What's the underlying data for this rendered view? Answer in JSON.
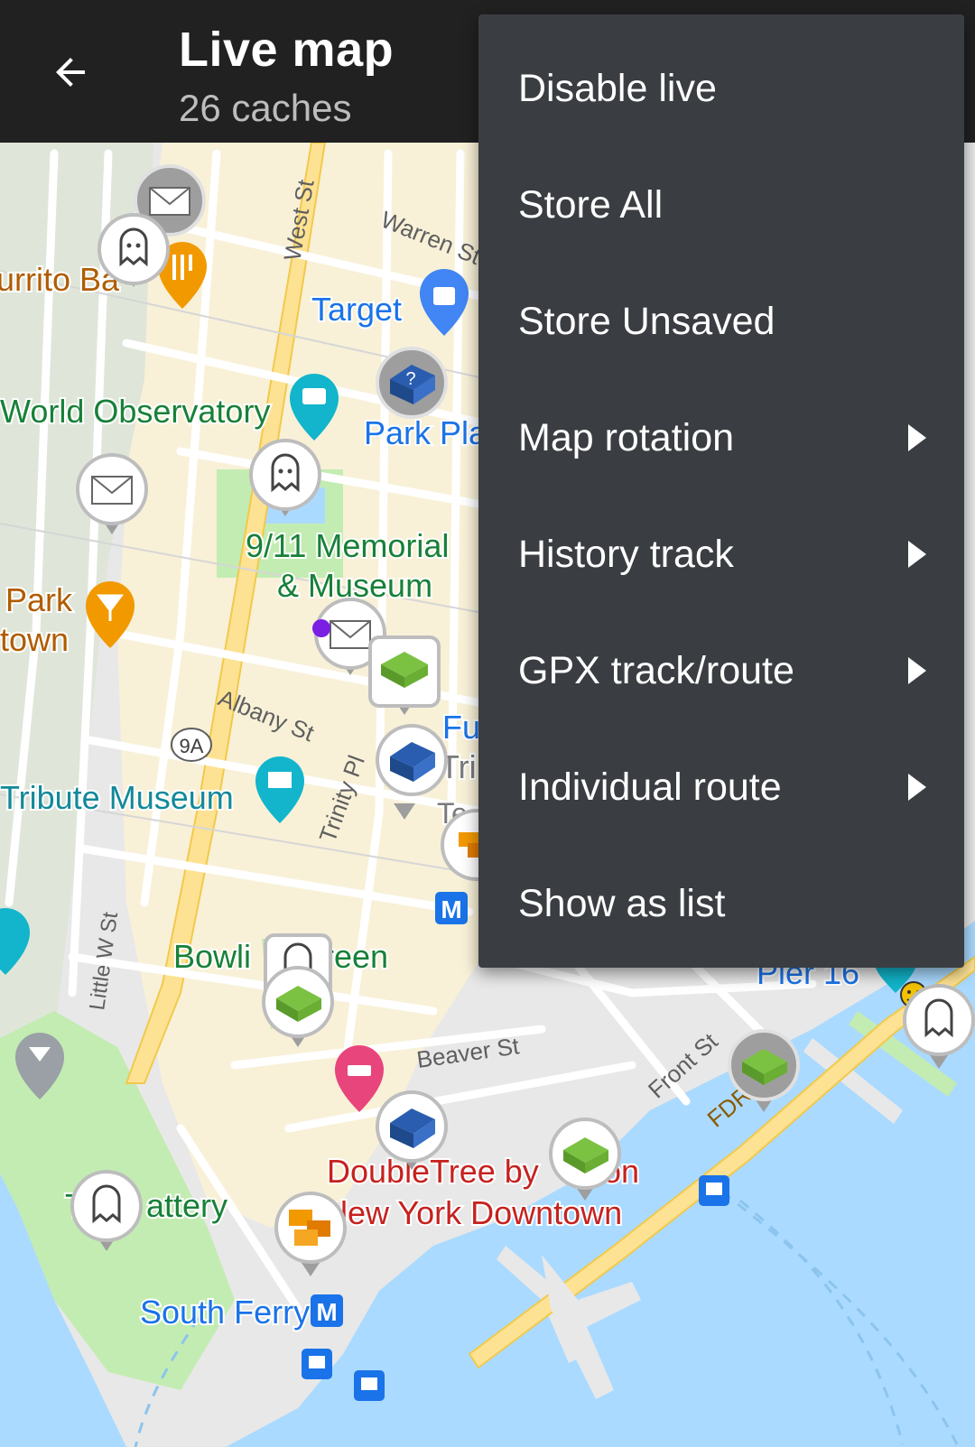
{
  "toolbar": {
    "title": "Live map",
    "subtitle": "26 caches",
    "back_icon": "arrow-back-icon"
  },
  "menu": {
    "items": [
      {
        "label": "Disable live",
        "submenu": false
      },
      {
        "label": "Store All",
        "submenu": false
      },
      {
        "label": "Store Unsaved",
        "submenu": false
      },
      {
        "label": "Map rotation",
        "submenu": true
      },
      {
        "label": "History track",
        "submenu": true
      },
      {
        "label": "GPX track/route",
        "submenu": true
      },
      {
        "label": "Individual route",
        "submenu": true
      },
      {
        "label": "Show as list",
        "submenu": false
      }
    ]
  },
  "map": {
    "labels": {
      "burrito": "urrito Ba",
      "west_st": "West St",
      "warren_st": "Warren St",
      "target": "Target",
      "world_observatory": "World Observatory",
      "park_pla": "Park Pla",
      "memorial_1": "9/11 Memorial",
      "memorial_2": "& Museum",
      "park": "Park",
      "town": "town",
      "albany_st": "Albany St",
      "route_9a": "9A",
      "fu": "Fu",
      "tri": "Tri",
      "te": "Te",
      "trinity_pl": "Trinity Pl",
      "tribute_museum": "Tribute Museum",
      "little_w_st": "Little W St",
      "bowling_green_1": "Bowli",
      "bowling_green_2": "reen",
      "pier": "Pier 16",
      "beaver_st": "Beaver St",
      "front_st": "Front St",
      "fdr": "FDR",
      "doubletree_1": "DoubleTree by",
      "doubletree_1b": "on",
      "doubletree_2": "lew York Downtown",
      "battery_1": "T",
      "battery_2": "attery",
      "south_ferry": "South Ferry",
      "metro": "M"
    },
    "colors": {
      "water": "#aadaff",
      "land": "#e8e8e8",
      "park": "#c3ecb2",
      "road_major": "#fde293",
      "road": "#ffffff",
      "park_label": "#1e7b34",
      "poi_orange": "#f29900",
      "poi_teal": "#12b5cb",
      "poi_blue": "#1a73e8",
      "hotel_pink": "#e8457c",
      "hotel_label": "#c5221f"
    },
    "cache_icons": [
      "envelope-cache-icon",
      "ghost-cache-icon",
      "mystery-cache-icon",
      "traditional-cache-icon",
      "multi-cache-icon"
    ]
  }
}
